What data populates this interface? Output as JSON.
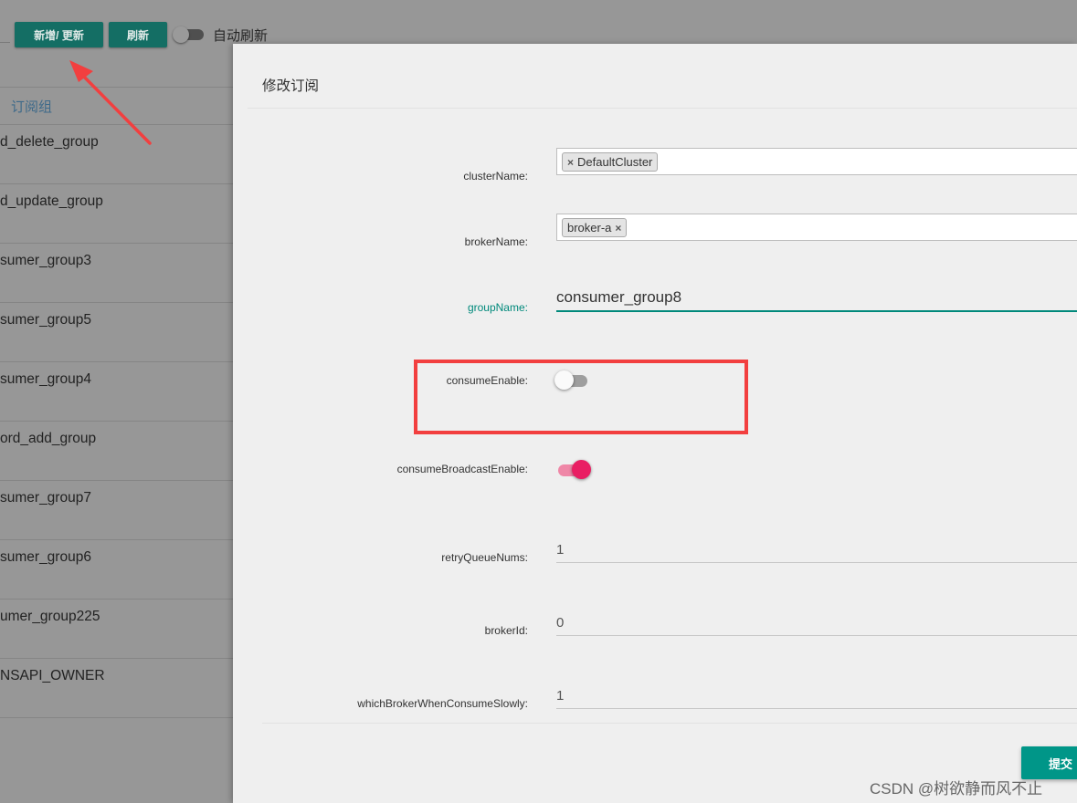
{
  "toolbar": {
    "add_update_label": "新增/ 更新",
    "refresh_label": "刷新",
    "auto_refresh_label": "自动刷新"
  },
  "table": {
    "header": "订阅组",
    "rows": [
      "d_delete_group",
      "d_update_group",
      "sumer_group3",
      "sumer_group5",
      "sumer_group4",
      "ord_add_group",
      "sumer_group7",
      "sumer_group6",
      "umer_group225",
      "NSAPI_OWNER"
    ]
  },
  "modal": {
    "title": "修改订阅",
    "fields": {
      "clusterName": {
        "label": "clusterName:",
        "tag": "DefaultCluster"
      },
      "brokerName": {
        "label": "brokerName:",
        "tag": "broker-a"
      },
      "groupName": {
        "label": "groupName:",
        "value": "consumer_group8"
      },
      "consumeEnable": {
        "label": "consumeEnable:",
        "on": false
      },
      "consumeBroadcastEnable": {
        "label": "consumeBroadcastEnable:",
        "on": true
      },
      "retryQueueNums": {
        "label": "retryQueueNums:",
        "value": "1"
      },
      "brokerId": {
        "label": "brokerId:",
        "value": "0"
      },
      "whichBrokerWhenConsumeSlowly": {
        "label": "whichBrokerWhenConsumeSlowly:",
        "value": "1"
      }
    },
    "tag_remove_symbol": "×",
    "submit_label": "提交"
  },
  "watermark": "CSDN @树欲静而风不止",
  "colors": {
    "primary": "#009688",
    "focus": "#00897b",
    "switch_on": "#e91e63",
    "annotation_red": "#f23f3f"
  }
}
